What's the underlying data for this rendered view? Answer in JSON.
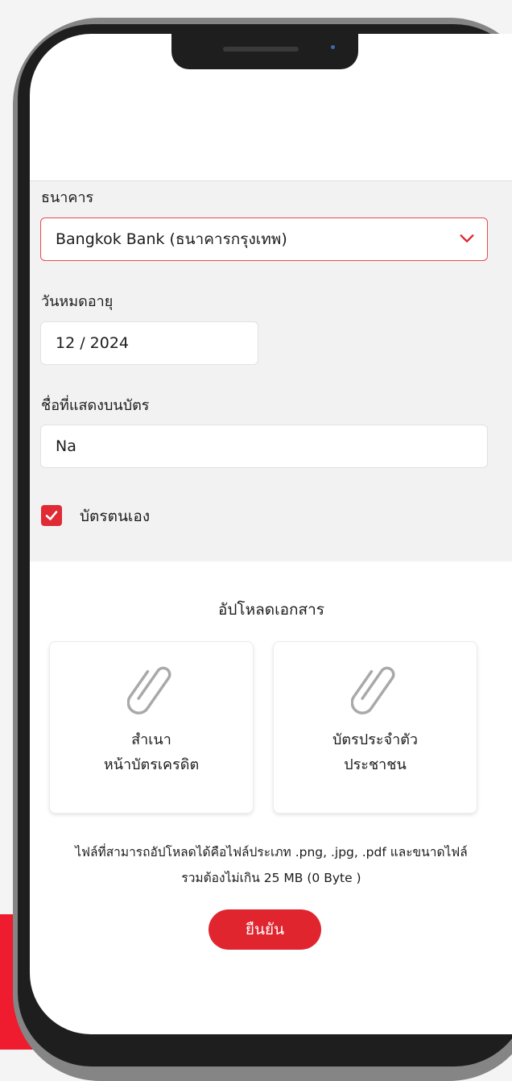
{
  "form": {
    "bank_label": "ธนาคาร",
    "bank_value": "Bangkok Bank (ธนาคารกรุงเทพ)",
    "expiry_label": "วันหมดอายุ",
    "expiry_value": "12 / 2024",
    "card_name_label": "ชื่อที่แสดงบนบัตร",
    "card_name_value": "Na",
    "own_card_label": "บัตรตนเอง",
    "own_card_checked": true
  },
  "upload": {
    "title": "อัปโหลดเอกสาร",
    "cards": [
      {
        "line1": "สำเนา",
        "line2": "หน้าบัตรเครดิต",
        "icon": "paperclip-icon"
      },
      {
        "line1": "บัตรประจำตัว",
        "line2": "ประชาชน",
        "icon": "paperclip-icon"
      }
    ],
    "note_line1": "ไฟล์ที่สามารถอัปโหลดได้คือไฟล์ประเภท .png, .jpg, .pdf และขนาดไฟล์",
    "note_line2": "รวมต้องไม่เกิน 25 MB (0 Byte )"
  },
  "actions": {
    "confirm_label": "ยืนยัน"
  },
  "colors": {
    "accent": "#e0252f",
    "select_border": "#e84a4f",
    "background_red": "#ee1c2e"
  }
}
